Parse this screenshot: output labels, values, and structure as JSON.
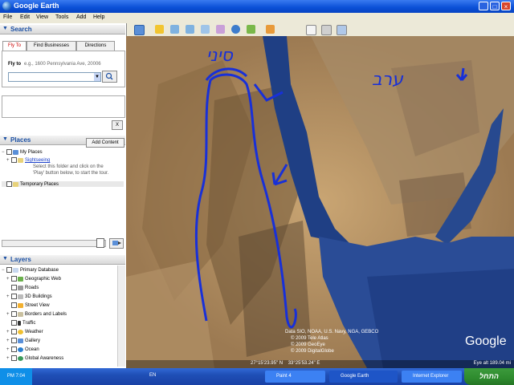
{
  "window": {
    "title": "Google Earth"
  },
  "menu": [
    "File",
    "Edit",
    "View",
    "Tools",
    "Add",
    "Help"
  ],
  "search": {
    "header": "Search",
    "tabs": [
      "Fly To",
      "Find Businesses",
      "Directions"
    ],
    "fly_to_label": "Fly to",
    "fly_to_hint": "e.g., 1600 Pennsylvania Ave, 20006",
    "clear_label": "X"
  },
  "places": {
    "header": "Places",
    "add_content": "Add Content",
    "my_places": "My Places",
    "sightseeing": "Sightseeing",
    "sightseeing_note_1": "Select this folder and click on the",
    "sightseeing_note_2": "'Play' button below, to start the tour.",
    "temporary": "Temporary Places"
  },
  "layers": {
    "header": "Layers",
    "items": [
      "Primary Database",
      "Geographic Web",
      "Roads",
      "3D Buildings",
      "Street View",
      "Borders and Labels",
      "Traffic",
      "Weather",
      "Gallery",
      "Ocean",
      "Global Awareness"
    ]
  },
  "map": {
    "annotations": {
      "left": "סיני",
      "right": "ערב"
    },
    "attribution_1": "Data SIO, NOAA, U.S. Navy, NGA, GEBCO",
    "attribution_2": "© 2009 Tele Atlas",
    "attribution_3": "© 2009 GeoEye",
    "attribution_4": "© 2009 DigitalGlobe",
    "coordinates": "27°15'23.95\" N    33°25'53.24\" E",
    "eye_alt": "Eye alt 189.04 mi",
    "brand": "Google"
  },
  "taskbar": {
    "clock": "PM 7:04",
    "language": "EN",
    "tasks": [
      "Paint 4",
      "Google Earth",
      "Internet Explorer"
    ],
    "start": "התחל"
  }
}
